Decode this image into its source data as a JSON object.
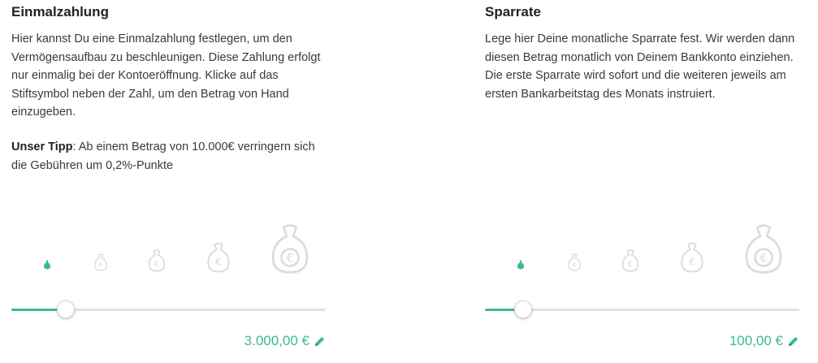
{
  "einmalzahlung": {
    "title": "Einmalzahlung",
    "description": "Hier kannst Du eine Einmalzahlung festlegen, um den Vermögensaufbau zu beschleunigen. Diese Zahlung erfolgt nur einmalig bei der Kontoeröffnung. Klicke auf das Stiftsymbol neben der Zahl, um den Betrag von Hand einzugeben.",
    "tip_label": "Unser Tipp",
    "tip_text": ": Ab einem Betrag von 10.000€ verringern sich die Gebühren um 0,2%-Punkte",
    "amount": "3.000,00 €",
    "slider_fraction": 0.17
  },
  "sparrate": {
    "title": "Sparrate",
    "description": "Lege hier Deine monatliche Sparrate fest. Wir werden dann diesen Betrag monatlich von Deinem Bankkonto einziehen. Die erste Sparrate wird sofort und die weiteren jeweils am ersten Bankarbeitstag des Monats instruiert.",
    "amount": "100,00 €",
    "slider_fraction": 0.12
  },
  "colors": {
    "accent": "#3dbb8e",
    "bag_inactive": "#d8dcdf",
    "track": "#e2e2e2"
  },
  "icons": {
    "bag": "money-bag-icon",
    "edit": "pencil-icon"
  }
}
